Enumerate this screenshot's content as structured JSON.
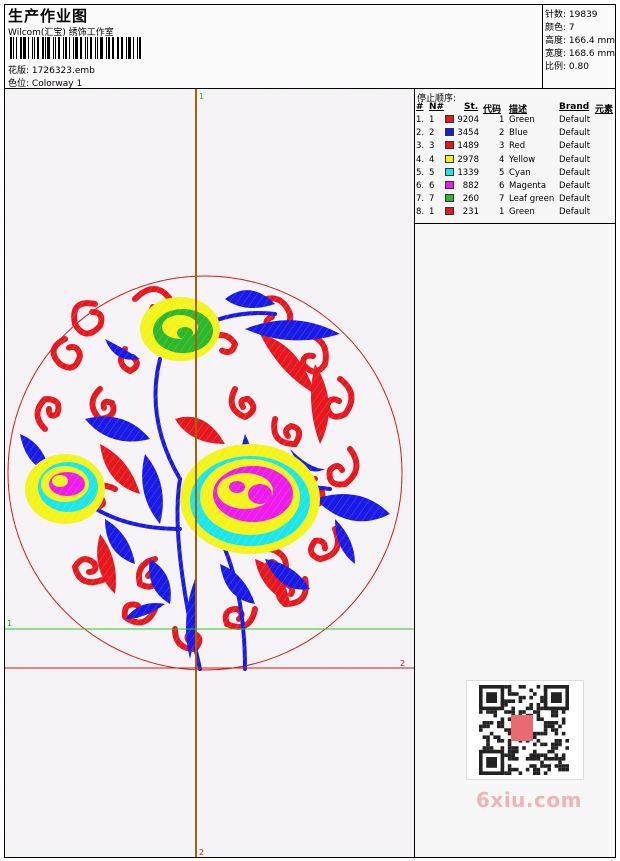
{
  "header": {
    "title": "生产作业图",
    "company": "Wilcom(汇宝) 绣饰工作室",
    "design_label": "花版:",
    "design_file": "1726323.emb",
    "colorway_label": "色位:",
    "colorway_value": "Colorway 1"
  },
  "stats": {
    "stitches": "针数: 19839",
    "colors": "颜色: 7",
    "height": "高度: 166.4 mm",
    "width": "宽度: 168.6 mm",
    "scale": "比例: 0.80"
  },
  "stop_sequence": {
    "title": "停止顺序:",
    "headers": [
      "#",
      "N#",
      "St.",
      "代码",
      "描述",
      "Brand",
      "元素"
    ],
    "rows": [
      {
        "num": "1.",
        "n": "1",
        "color": "#e8171d",
        "st": "9204",
        "code": "1",
        "desc": "Green",
        "brand": "Default"
      },
      {
        "num": "2.",
        "n": "2",
        "color": "#1a1ae8",
        "st": "3454",
        "code": "2",
        "desc": "Blue",
        "brand": "Default"
      },
      {
        "num": "3.",
        "n": "3",
        "color": "#e8171d",
        "st": "1489",
        "code": "3",
        "desc": "Red",
        "brand": "Default"
      },
      {
        "num": "4.",
        "n": "4",
        "color": "#f4f41a",
        "st": "2978",
        "code": "4",
        "desc": "Yellow",
        "brand": "Default"
      },
      {
        "num": "5.",
        "n": "5",
        "color": "#1ae6ec",
        "st": "1339",
        "code": "5",
        "desc": "Cyan",
        "brand": "Default"
      },
      {
        "num": "6.",
        "n": "6",
        "color": "#ee1aee",
        "st": "882",
        "code": "6",
        "desc": "Magenta",
        "brand": "Default"
      },
      {
        "num": "7.",
        "n": "7",
        "color": "#2cb82c",
        "st": "260",
        "code": "7",
        "desc": "Leaf green",
        "brand": "Default"
      },
      {
        "num": "8.",
        "n": "1",
        "color": "#e8171d",
        "st": "231",
        "code": "1",
        "desc": "Green",
        "brand": "Default"
      }
    ]
  },
  "guides": {
    "v_top": "1",
    "v_bottom": "2",
    "h_green": "1",
    "h_red": "2"
  },
  "colors": {
    "red": "#e8171d",
    "blue": "#1a1ae8",
    "yellow": "#f4f41a",
    "cyan": "#1ae6ec",
    "magenta": "#ee1aee",
    "leaf_green": "#2cb82c",
    "guide_brown": "#a0620a",
    "guide_green": "#22cc22",
    "guide_red": "#d01818"
  },
  "watermark": "6xiu.com"
}
